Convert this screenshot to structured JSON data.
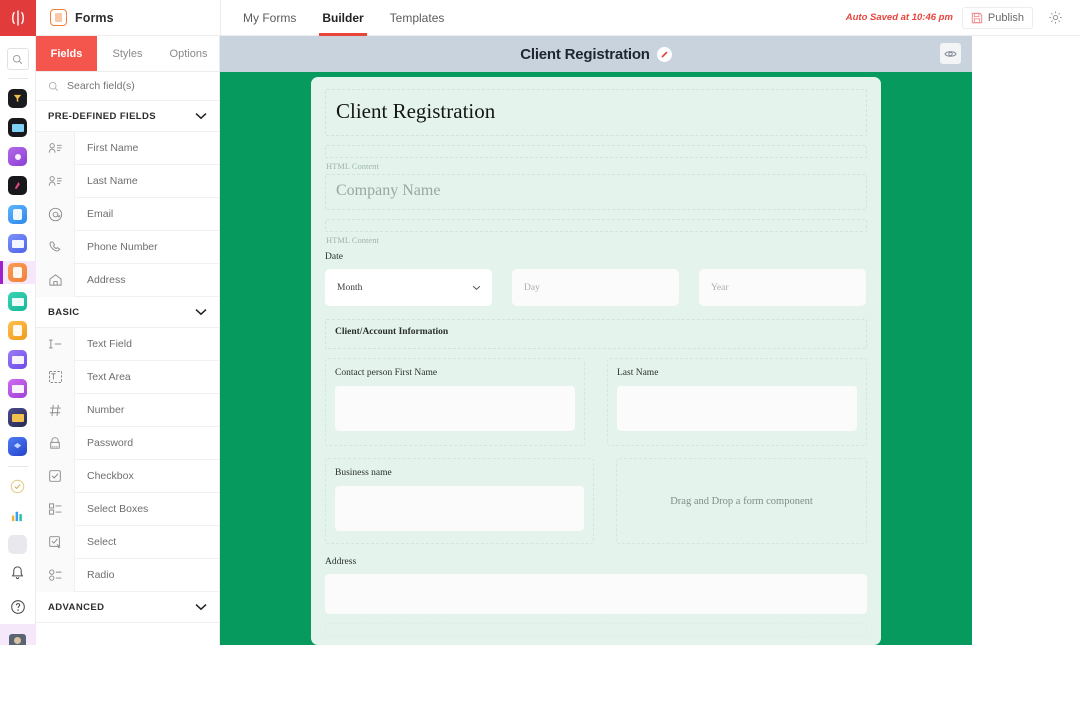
{
  "rail": {
    "logo_name": "workspace-logo",
    "search_placeholder": "",
    "items": [
      {
        "name": "funnel-app",
        "color": "#1b1b1f",
        "shape": "funnel"
      },
      {
        "name": "sheets-app",
        "color": "#17171c",
        "shape": "wide"
      },
      {
        "name": "location-app",
        "color": "#a24bdc",
        "shape": "dot"
      },
      {
        "name": "rocket-app",
        "color": "#17171c",
        "shape": "dot"
      },
      {
        "name": "docs-app",
        "color": "#3d9bf5",
        "shape": "doc"
      },
      {
        "name": "mail-app",
        "color": "#5b7cf7",
        "shape": "wide"
      },
      {
        "name": "forms-app",
        "color": "#f2803c",
        "shape": "doc",
        "active": true
      },
      {
        "name": "tables-app",
        "color": "#21c3a6",
        "shape": "wide"
      },
      {
        "name": "boards-app",
        "color": "#f0a52a",
        "shape": "doc"
      },
      {
        "name": "chat-app",
        "color": "#7b5cf0",
        "shape": "wide"
      },
      {
        "name": "crm-app",
        "color": "#b44ae0",
        "shape": "wide"
      },
      {
        "name": "terminal-app",
        "color": "#2f2f55",
        "shape": "wide"
      },
      {
        "name": "layers-app",
        "color": "#2f62e8",
        "shape": "dot"
      }
    ],
    "tools": [
      {
        "name": "tasks-check-app",
        "color": "#e9c46a",
        "shape": "check"
      },
      {
        "name": "analytics-app",
        "color": "#ffffff",
        "shape": "bars"
      }
    ],
    "bottom": [
      {
        "name": "notifications-bell",
        "label": "bell-icon"
      },
      {
        "name": "help-button",
        "label": "question-icon"
      }
    ],
    "avatar_name": "user-avatar"
  },
  "header": {
    "brand": "Forms",
    "brand_icon": "forms-icon",
    "nav": [
      {
        "label": "My Forms",
        "active": false
      },
      {
        "label": "Builder",
        "active": true
      },
      {
        "label": "Templates",
        "active": false
      }
    ],
    "autosave": "Auto Saved at 10:46 pm",
    "publish_label": "Publish",
    "publish_icon": "save-icon",
    "gear_icon": "gear-icon"
  },
  "panel": {
    "tabs": [
      {
        "label": "Fields",
        "active": true
      },
      {
        "label": "Styles",
        "active": false
      },
      {
        "label": "Options",
        "active": false
      }
    ],
    "search_placeholder": "Search field(s)",
    "search_value": "",
    "groups": [
      {
        "title": "PRE-DEFINED FIELDS",
        "expanded": true,
        "fields": [
          {
            "label": "First Name",
            "icon": "person-lines-icon"
          },
          {
            "label": "Last Name",
            "icon": "person-lines-icon"
          },
          {
            "label": "Email",
            "icon": "at-sign-icon"
          },
          {
            "label": "Phone Number",
            "icon": "phone-icon"
          },
          {
            "label": "Address",
            "icon": "home-icon"
          }
        ]
      },
      {
        "title": "BASIC",
        "expanded": true,
        "fields": [
          {
            "label": "Text Field",
            "icon": "text-cursor-icon"
          },
          {
            "label": "Text Area",
            "icon": "text-area-icon"
          },
          {
            "label": "Number",
            "icon": "hash-icon"
          },
          {
            "label": "Password",
            "icon": "lock-icon"
          },
          {
            "label": "Checkbox",
            "icon": "checkbox-icon"
          },
          {
            "label": "Select Boxes",
            "icon": "select-boxes-icon"
          },
          {
            "label": "Select",
            "icon": "select-icon"
          },
          {
            "label": "Radio",
            "icon": "radio-icon"
          }
        ]
      },
      {
        "title": "ADVANCED",
        "expanded": false,
        "fields": []
      }
    ]
  },
  "canvas": {
    "form_title": "Client Registration",
    "edit_icon": "pencil-icon",
    "preview_icon": "eye-icon"
  },
  "form": {
    "heading": "Client Registration",
    "html_content_label_1": "HTML Content",
    "company_name": "Company Name",
    "html_content_label_2": "HTML Content",
    "date_label": "Date",
    "month_value": "Month",
    "day_placeholder": "Day",
    "year_placeholder": "Year",
    "section_heading": "Client/Account Information",
    "contact_first_label": "Contact person First Name",
    "contact_first_value": "",
    "last_name_label": "Last Name",
    "last_name_value": "",
    "business_label": "Business name",
    "business_value": "",
    "dropzone_text": "Drag and Drop a form component",
    "address_label": "Address",
    "address_value": ""
  },
  "colors": {
    "brand_red": "#e8453c",
    "tab_active": "#f4564e",
    "canvas_green": "#079a5e",
    "card_mint": "#e4f4ec",
    "header_slate": "#c9d3de",
    "accent_purple": "#a020d0"
  }
}
